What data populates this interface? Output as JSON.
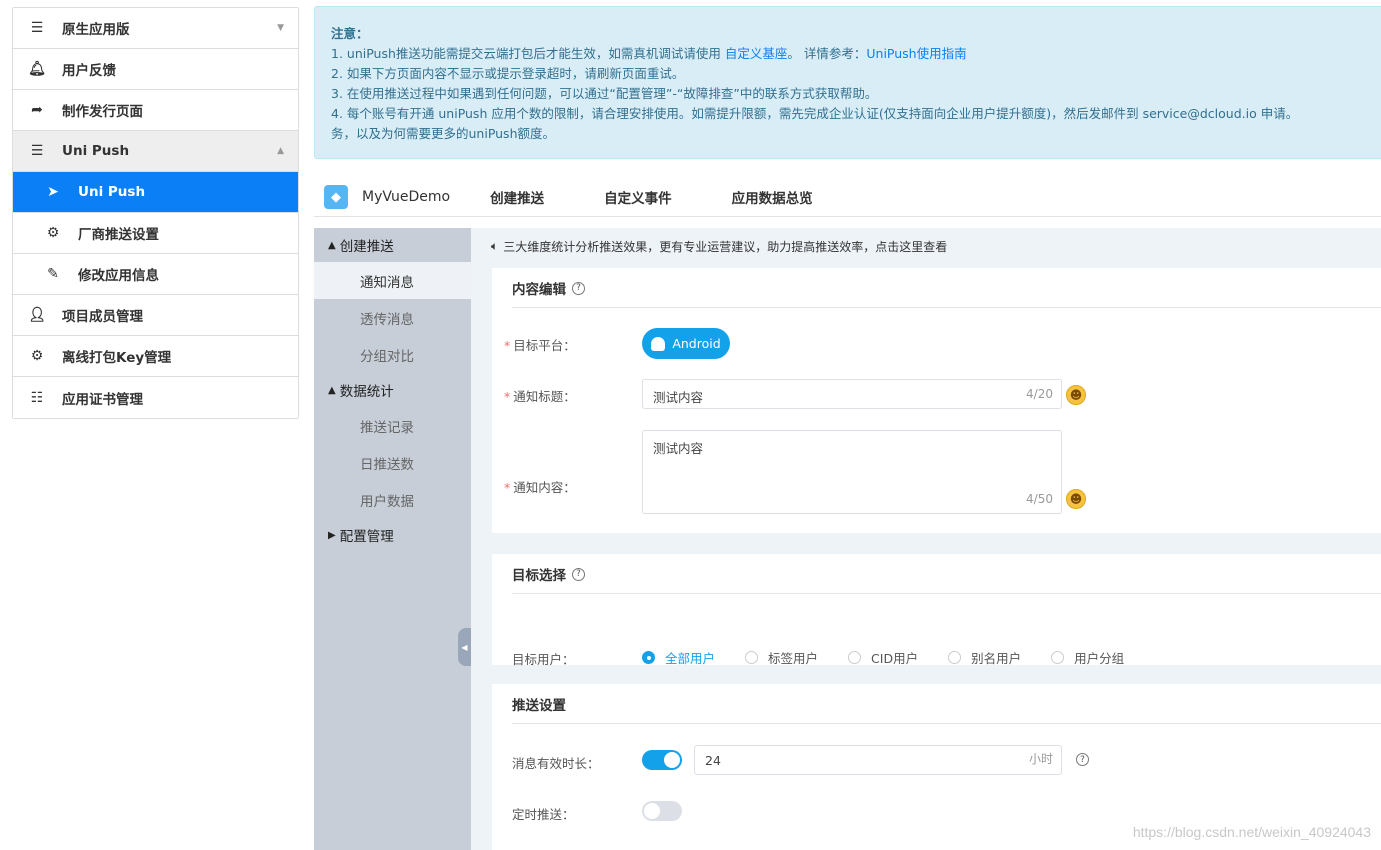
{
  "sidebar": {
    "items": [
      {
        "label": "原生应用版",
        "icon": "menu-icon"
      },
      {
        "label": "用户反馈",
        "icon": "bell-icon"
      },
      {
        "label": "制作发行页面",
        "icon": "share-arrow-icon"
      },
      {
        "label": "Uni Push",
        "icon": "menu-icon"
      },
      {
        "label": "Uni Push",
        "icon": "paper-plane-icon"
      },
      {
        "label": "厂商推送设置",
        "icon": "gear-icon"
      },
      {
        "label": "修改应用信息",
        "icon": "edit-icon"
      },
      {
        "label": "项目成员管理",
        "icon": "user-icon"
      },
      {
        "label": "离线打包Key管理",
        "icon": "gear-icon"
      },
      {
        "label": "应用证书管理",
        "icon": "list-icon"
      }
    ]
  },
  "notice": {
    "title": "注意：",
    "line1_pre": "1. uniPush推送功能需提交云端打包后才能生效，如需真机调试请使用 ",
    "line1_link1": "自定义基座",
    "line1_mid": "。 详情参考：",
    "line1_link2": "UniPush使用指南",
    "line2": "2. 如果下方页面内容不显示或提示登录超时，请刷新页面重试。",
    "line3": "3. 在使用推送过程中如果遇到任何问题，可以通过“配置管理”-“故障排查”中的联系方式获取帮助。",
    "line4": "4. 每个账号有开通 uniPush 应用个数的限制，请合理安排使用。如需提升限额，需先完成企业认证(仅支持面向企业用户提升额度)，然后发邮件到 service@dcloud.io 申请。",
    "line5": "务，以及为何需要更多的uniPush额度。"
  },
  "topnav": {
    "app_name": "MyVueDemo",
    "tabs": [
      "创建推送",
      "自定义事件",
      "应用数据总览"
    ]
  },
  "submenu": {
    "group1": "创建推送",
    "group1_items": [
      "通知消息",
      "透传消息",
      "分组对比"
    ],
    "group2": "数据统计",
    "group2_items": [
      "推送记录",
      "日推送数",
      "用户数据"
    ],
    "group3": "配置管理"
  },
  "tip": "三大维度统计分析推送效果，更有专业运营建议，助力提高推送效率，点击这里查看",
  "content_card": {
    "title": "内容编辑",
    "platform_label": "目标平台：",
    "platform_btn": "Android",
    "title_label": "通知标题：",
    "title_value": "测试内容",
    "title_count": "4/20",
    "content_label": "通知内容：",
    "content_value": "测试内容",
    "content_count": "4/50"
  },
  "target_card": {
    "title": "目标选择",
    "user_label": "目标用户：",
    "options": [
      "全部用户",
      "标签用户",
      "CID用户",
      "别名用户",
      "用户分组"
    ],
    "selected": "全部用户"
  },
  "push_card": {
    "title": "推送设置",
    "valid_label": "消息有效时长：",
    "valid_value": "24",
    "valid_unit": "小时",
    "schedule_label": "定时推送："
  },
  "watermark": "https://blog.csdn.net/weixin_40924043",
  "colors": {
    "accent": "#0b7ff6",
    "primary": "#13a1ea",
    "notice_bg": "#d9edf7"
  }
}
